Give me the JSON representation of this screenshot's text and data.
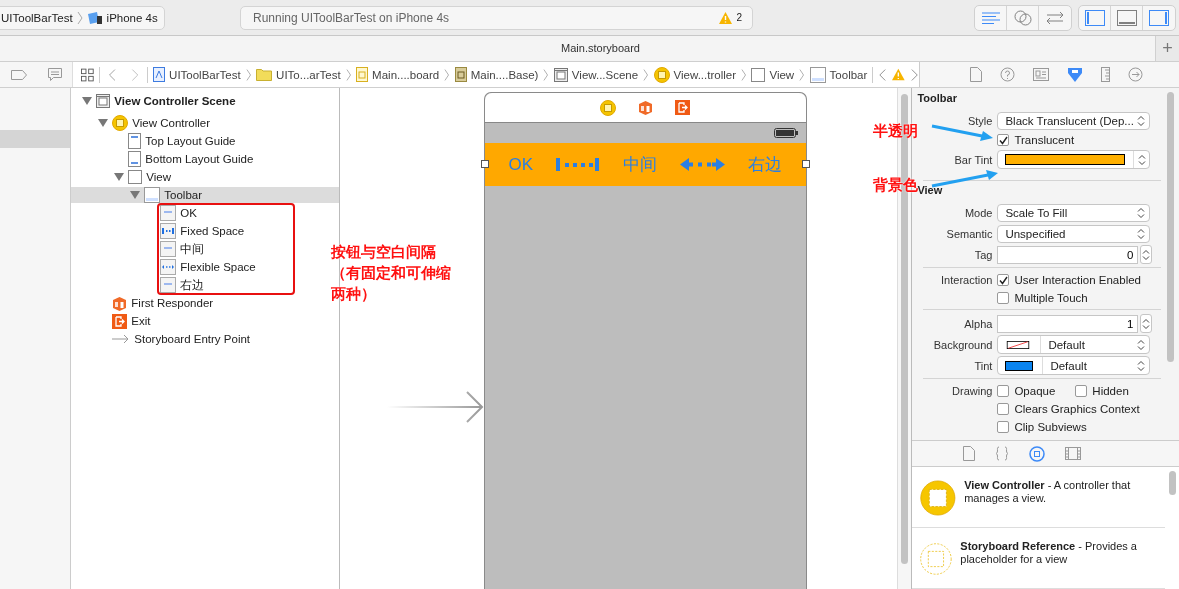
{
  "toolbar": {
    "scheme": [
      "UIToolBarTest",
      "iPhone 4s"
    ],
    "status": "Running UIToolBarTest on iPhone 4s",
    "warning_count": "2",
    "editor_buttons": [
      {
        "kind": "standard",
        "selected": true
      },
      {
        "kind": "assistant",
        "selected": false
      },
      {
        "kind": "version",
        "selected": false
      }
    ],
    "panel_buttons": [
      {
        "kind": "left",
        "selected": true
      },
      {
        "kind": "bottom",
        "selected": false
      },
      {
        "kind": "right",
        "selected": true
      }
    ]
  },
  "tab_bar": {
    "title": "Main.storyboard",
    "add": "+"
  },
  "jump_bar": [
    {
      "kind": "project",
      "label": "UIToolBarTest"
    },
    {
      "kind": "folder",
      "label": "UITo...arTest"
    },
    {
      "kind": "storyboard",
      "label": "Main....board"
    },
    {
      "kind": "storyboard_base",
      "label": "Main....Base)"
    },
    {
      "kind": "scene",
      "label": "View...Scene"
    },
    {
      "kind": "controller",
      "label": "View...troller"
    },
    {
      "kind": "view",
      "label": "View"
    },
    {
      "kind": "toolbar",
      "label": "Toolbar"
    }
  ],
  "outline": [
    {
      "kind": "scene",
      "label": "View Controller Scene",
      "expanded": true,
      "selected": false,
      "children": [
        {
          "kind": "controller",
          "label": "View Controller",
          "expanded": true,
          "selected": false,
          "children": [
            {
              "kind": "guide_top",
              "label": "Top Layout Guide",
              "selected": false
            },
            {
              "kind": "guide_bottom",
              "label": "Bottom Layout Guide",
              "selected": false
            },
            {
              "kind": "view",
              "label": "View",
              "expanded": true,
              "selected": false,
              "children": [
                {
                  "kind": "toolbar",
                  "label": "Toolbar",
                  "expanded": true,
                  "selected": true,
                  "children": [
                    {
                      "kind": "item",
                      "label": "OK",
                      "selected": false
                    },
                    {
                      "kind": "fixed_space",
                      "label": "Fixed Space",
                      "selected": false
                    },
                    {
                      "kind": "item",
                      "label": "中间",
                      "selected": false
                    },
                    {
                      "kind": "flexible_space",
                      "label": "Flexible Space",
                      "selected": false
                    },
                    {
                      "kind": "item",
                      "label": "右边",
                      "selected": false
                    }
                  ]
                }
              ]
            }
          ]
        },
        {
          "kind": "responder",
          "label": "First Responder",
          "selected": false
        },
        {
          "kind": "exit",
          "label": "Exit",
          "selected": false
        },
        {
          "kind": "entry",
          "label": "Storyboard Entry Point",
          "selected": false
        }
      ]
    }
  ],
  "canvas": {
    "items": [
      {
        "kind": "text",
        "label": "OK"
      },
      {
        "kind": "fixed_space"
      },
      {
        "kind": "text",
        "label": "中间"
      },
      {
        "kind": "flexible_space"
      },
      {
        "kind": "text",
        "label": "右边"
      }
    ]
  },
  "inspector": {
    "tabs": [
      {
        "kind": "file",
        "selected": false
      },
      {
        "kind": "help",
        "selected": false
      },
      {
        "kind": "identity",
        "selected": false
      },
      {
        "kind": "attributes",
        "selected": true
      },
      {
        "kind": "size",
        "selected": false
      },
      {
        "kind": "connections",
        "selected": false
      }
    ],
    "toolbar_section": {
      "title": "Toolbar",
      "style_label": "Style",
      "style": "Black Translucent (Dep...",
      "translucent": {
        "label": "Translucent",
        "checked": true
      },
      "bar_tint_label": "Bar Tint"
    },
    "view_section": {
      "title": "View",
      "mode_label": "Mode",
      "mode": "Scale To Fill",
      "semantic_label": "Semantic",
      "semantic": "Unspecified",
      "tag_label": "Tag",
      "tag": "0",
      "interaction_label": "Interaction",
      "interaction": [
        {
          "label": "User Interaction Enabled",
          "checked": true
        },
        {
          "label": "Multiple Touch",
          "checked": false
        }
      ],
      "alpha_label": "Alpha",
      "alpha": "1",
      "background_label": "Background",
      "background": "Default",
      "tint_label": "Tint",
      "tint": "Default",
      "drawing_label": "Drawing",
      "drawing": [
        {
          "label": "Opaque",
          "checked": false
        },
        {
          "label": "Hidden",
          "checked": false
        },
        {
          "label": "Clears Graphics Context",
          "checked": false
        },
        {
          "label": "Clip Subviews",
          "checked": false
        }
      ]
    }
  },
  "library": {
    "tabs": [
      {
        "kind": "file",
        "selected": false
      },
      {
        "kind": "code",
        "selected": false
      },
      {
        "kind": "object",
        "selected": true
      },
      {
        "kind": "media",
        "selected": false
      }
    ],
    "items": [
      {
        "kind": "controller",
        "text": "**View Controller** - A controller that manages a view."
      },
      {
        "kind": "reference",
        "text": "**Storyboard Reference** - Provides a placeholder for a view"
      }
    ]
  },
  "annotations": {
    "outline_note": [
      "按钮与空白间隔",
      "（有固定和可伸缩",
      "两种）"
    ],
    "translucent_note": "半透明",
    "tint_note": "背景色"
  }
}
